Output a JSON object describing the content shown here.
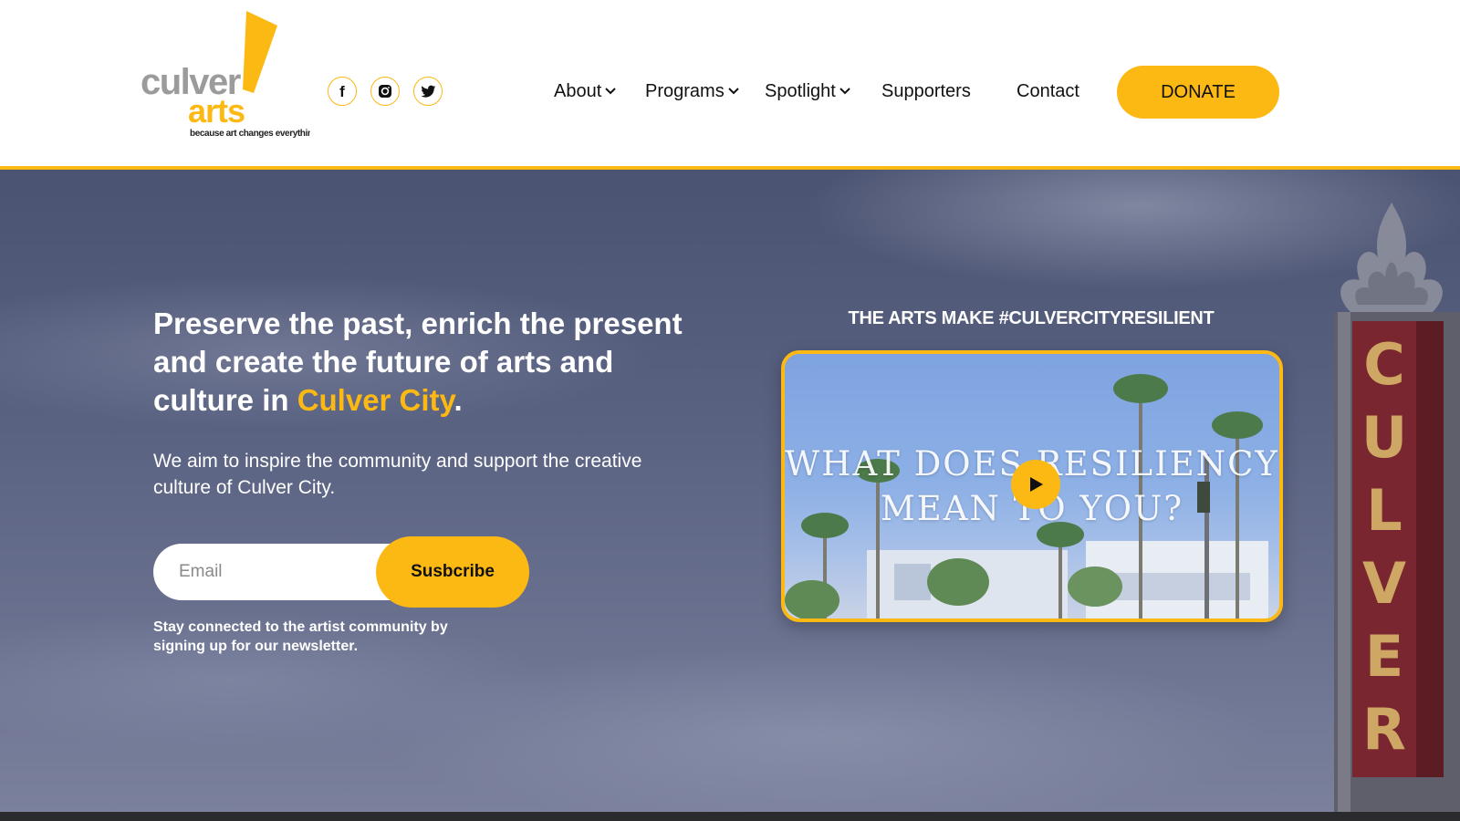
{
  "brand": {
    "logo_line1": "culver",
    "logo_line2": "arts",
    "tagline": "because art changes everything",
    "accent_color": "#FDB913"
  },
  "social": [
    {
      "name": "facebook-icon",
      "glyph": "f"
    },
    {
      "name": "instagram-icon"
    },
    {
      "name": "twitter-icon"
    }
  ],
  "nav": {
    "about": "About",
    "programs": "Programs",
    "spotlight": "Spotlight",
    "supporters": "Supporters",
    "contact": "Contact",
    "donate": "DONATE"
  },
  "hero": {
    "headline_part1": "Preserve the past, enrich the present and create the future of arts and culture in ",
    "headline_accent": "Culver City",
    "headline_end": ".",
    "subtext": "We aim to inspire the community and support the creative culture of Culver City.",
    "email_placeholder": "Email",
    "subscribe_label": "Susbcribe",
    "newsletter_note": "Stay connected to the artist community by signing up for our newsletter.",
    "tower_letters": [
      "C",
      "U",
      "L",
      "V",
      "E",
      "R"
    ]
  },
  "video": {
    "label": "THE ARTS MAKE #CULVERCITYRESILIENT",
    "title_line1": "WHAT DOES RESILIENCY",
    "title_line2": "MEAN TO YOU?",
    "play_icon": "play-icon"
  }
}
